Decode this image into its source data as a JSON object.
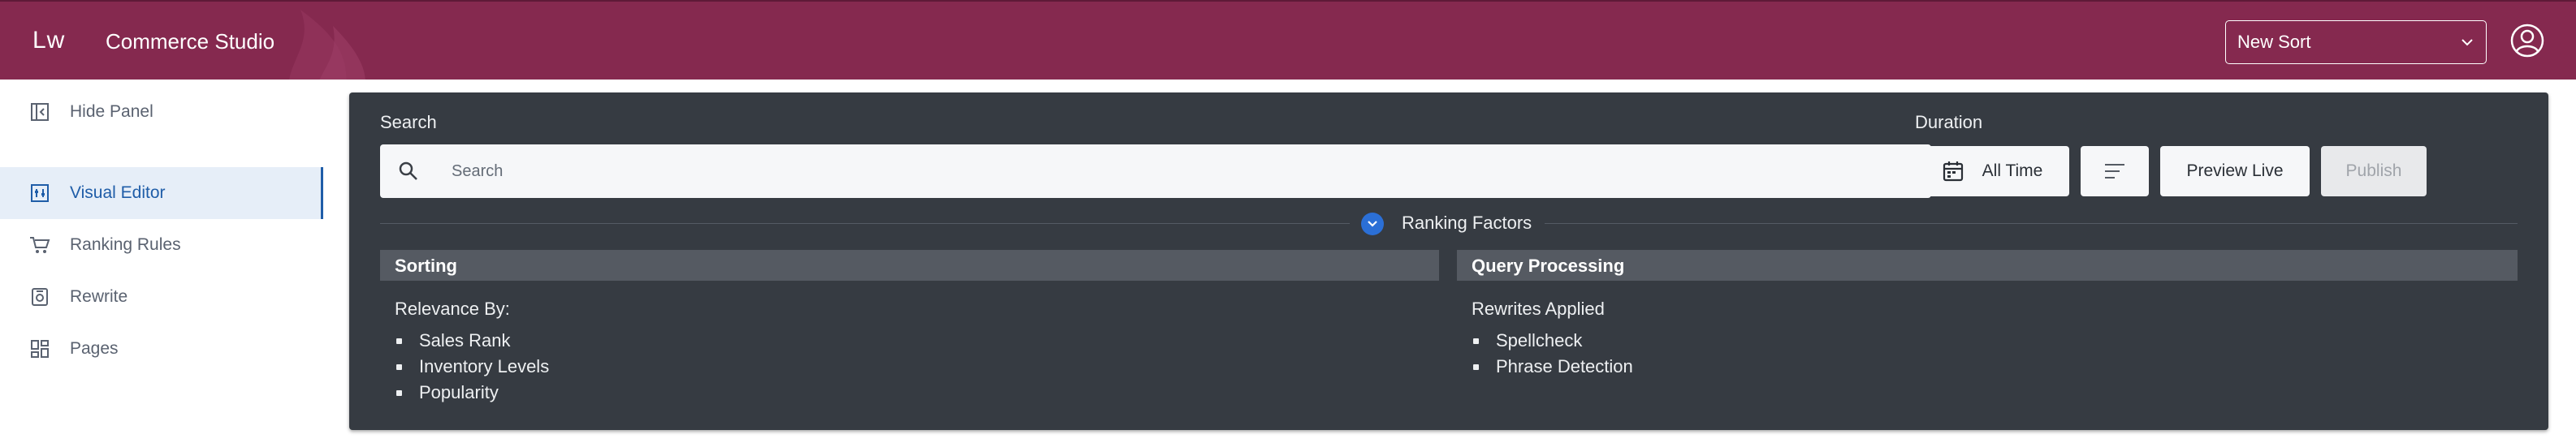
{
  "header": {
    "logo": "Lw",
    "title": "Commerce Studio",
    "sort_select": {
      "value": "New Sort"
    }
  },
  "sidebar": {
    "items": [
      {
        "label": "Hide Panel",
        "icon": "hide-panel-icon",
        "active": false
      },
      {
        "label": "Visual Editor",
        "icon": "visual-editor-icon",
        "active": true
      },
      {
        "label": "Ranking Rules",
        "icon": "cart-icon",
        "active": false
      },
      {
        "label": "Rewrite",
        "icon": "rewrite-icon",
        "active": false
      },
      {
        "label": "Pages",
        "icon": "pages-icon",
        "active": false
      }
    ]
  },
  "main": {
    "search_label": "Search",
    "search_placeholder": "Search",
    "duration_label": "Duration",
    "duration_button": "All Time",
    "preview_button": "Preview Live",
    "publish_button": "Publish",
    "ranking_factors_label": "Ranking Factors",
    "sorting": {
      "title": "Sorting",
      "subtitle": "Relevance By:",
      "items": [
        "Sales Rank",
        "Inventory Levels",
        "Popularity"
      ]
    },
    "query_processing": {
      "title": "Query Processing",
      "subtitle": "Rewrites Applied",
      "items": [
        "Spellcheck",
        "Phrase Detection"
      ]
    }
  },
  "colors": {
    "header_bg": "#85294f",
    "panel_bg": "#363b42",
    "accent": "#1f5da8",
    "toggle": "#2b6fd6"
  }
}
